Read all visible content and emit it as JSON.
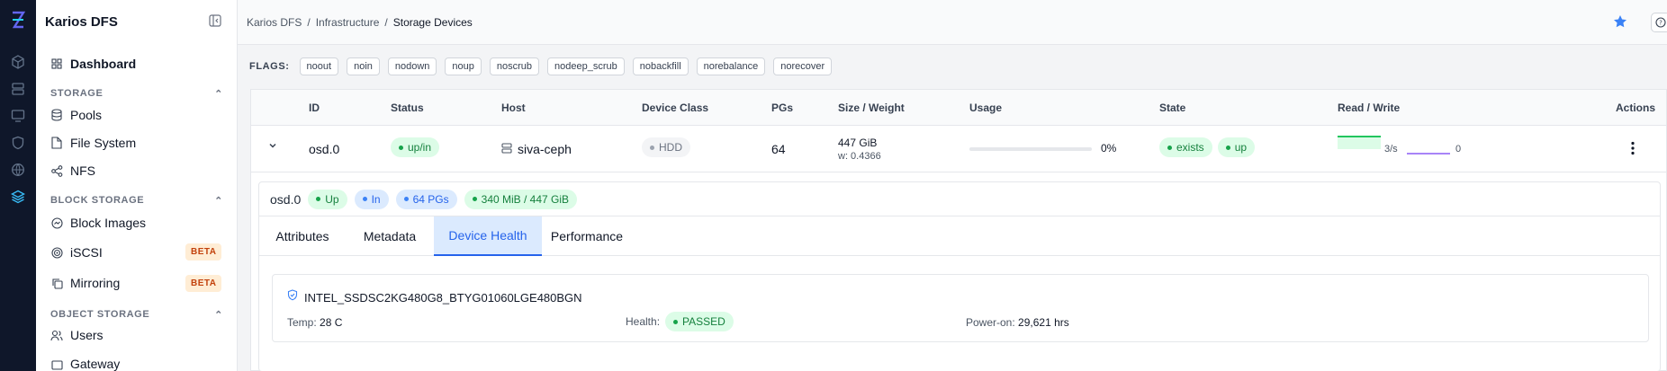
{
  "app": {
    "title": "Karios DFS"
  },
  "breadcrumb": [
    "Karios DFS",
    "Infrastructure",
    "Storage Devices"
  ],
  "sidebar": {
    "dashboard": "Dashboard",
    "storage_label": "STORAGE",
    "pools": "Pools",
    "filesystem": "File System",
    "nfs": "NFS",
    "block_label": "BLOCK STORAGE",
    "block_images": "Block Images",
    "iscsi": "iSCSI",
    "mirroring": "Mirroring",
    "beta": "BETA",
    "object_label": "OBJECT STORAGE",
    "users": "Users",
    "gateway": "Gateway"
  },
  "flags": {
    "label": "FLAGS:",
    "items": [
      "noout",
      "noin",
      "nodown",
      "noup",
      "noscrub",
      "nodeep_scrub",
      "nobackfill",
      "norebalance",
      "norecover"
    ]
  },
  "table": {
    "headers": [
      "ID",
      "Status",
      "Host",
      "Device Class",
      "PGs",
      "Size / Weight",
      "Usage",
      "State",
      "Read / Write",
      "Actions"
    ],
    "row": {
      "id": "osd.0",
      "status": "up/in",
      "host": "siva-ceph",
      "device_class": "HDD",
      "pgs": "64",
      "size": "447 GiB",
      "weight": "w: 0.4366",
      "usage_percent": 0,
      "usage_label": "0%",
      "state": [
        "exists",
        "up"
      ],
      "read": "3/s",
      "write": "0"
    }
  },
  "detail": {
    "id": "osd.0",
    "badges": [
      "Up",
      "In",
      "64 PGs",
      "340 MiB / 447 GiB"
    ],
    "tabs": [
      "Attributes",
      "Metadata",
      "Device Health",
      "Performance"
    ],
    "active_tab": "Device Health",
    "device": "INTEL_SSDSC2KG480G8_BTYG01060LGE480BGN",
    "temp_label": "Temp:",
    "temp": "28 C",
    "health_label": "Health:",
    "health": "PASSED",
    "power_label": "Power-on:",
    "power": "29,621 hrs"
  },
  "colors": {
    "accent": "#2563eb",
    "ok": "#16a34a",
    "beta": "#c2410c",
    "rail": "#0f172a"
  }
}
